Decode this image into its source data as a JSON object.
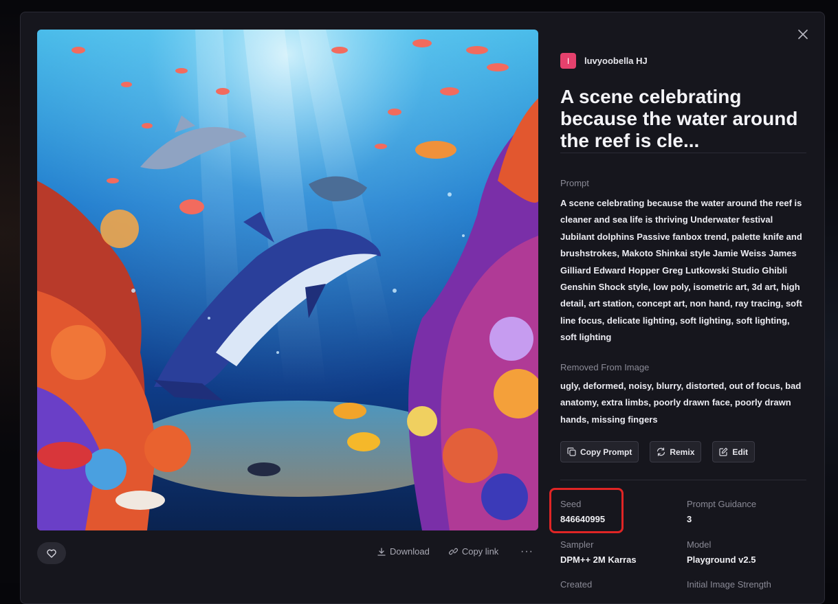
{
  "user": {
    "initial": "I",
    "name": "luvyoobella HJ",
    "avatar_color": "#e5416d"
  },
  "title": "A scene celebrating because the water around the reef is cle...",
  "prompt": {
    "label": "Prompt",
    "text": "A scene celebrating because the water around the reef is cleaner and sea life is thriving Underwater festival Jubilant dolphins Passive fanbox trend, palette knife and brushstrokes, Makoto Shinkai style Jamie Weiss James Gilliard Edward Hopper Greg Lutkowski Studio Ghibli Genshin Shock style, low poly, isometric art, 3d art, high detail, art station, concept art, non hand, ray tracing, soft line focus, delicate lighting, soft lighting, soft lighting, soft lighting"
  },
  "negative": {
    "label": "Removed From Image",
    "text": "ugly, deformed, noisy, blurry, distorted, out of focus, bad anatomy, extra limbs, poorly drawn face, poorly drawn hands, missing fingers"
  },
  "buttons": {
    "copy_prompt": "Copy Prompt",
    "remix": "Remix",
    "edit": "Edit"
  },
  "image_actions": {
    "download": "Download",
    "copy_link": "Copy link",
    "more": "···"
  },
  "meta": {
    "seed": {
      "label": "Seed",
      "value": "846640995"
    },
    "guidance": {
      "label": "Prompt Guidance",
      "value": "3"
    },
    "sampler": {
      "label": "Sampler",
      "value": "DPM++ 2M Karras"
    },
    "model": {
      "label": "Model",
      "value": "Playground v2.5"
    },
    "cut_left": "Created",
    "cut_right": "Initial Image Strength"
  },
  "colors": {
    "highlight": "#e02525",
    "modal_bg": "#16161d"
  },
  "icons": [
    "close-icon",
    "heart-icon",
    "download-icon",
    "link-icon",
    "copy-icon",
    "remix-icon",
    "edit-icon"
  ]
}
